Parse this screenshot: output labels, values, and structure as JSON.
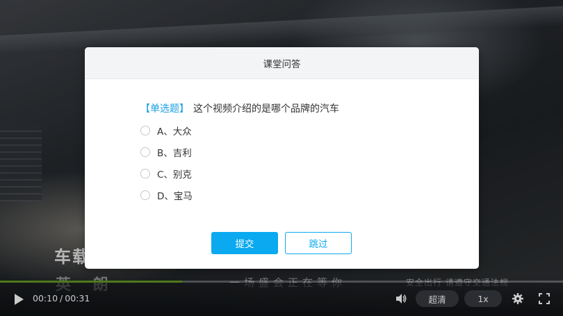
{
  "video": {
    "overlay_title": "车载",
    "overlay_title_2": "英 朗",
    "overlay_subtitle": "一场盛会正在等你",
    "overlay_notice": "安全出行 请遵守交通法规",
    "progress_fraction": 0.323
  },
  "player": {
    "current_time": "00:10",
    "separator": "/",
    "duration": "00:31",
    "quality_label": "超清",
    "speed_label": "1x",
    "icons": {
      "play": "play-icon",
      "volume": "volume-icon",
      "settings": "gear-icon",
      "fullscreen": "fullscreen-icon"
    }
  },
  "quiz": {
    "title": "课堂问答",
    "question_type": "【单选题】",
    "question_text": "这个视频介绍的是哪个品牌的汽车",
    "options": [
      {
        "label": "A、大众"
      },
      {
        "label": "B、吉利"
      },
      {
        "label": "C、别克"
      },
      {
        "label": "D、宝马"
      }
    ],
    "submit_label": "提交",
    "skip_label": "跳过"
  },
  "colors": {
    "accent": "#0aa9f0",
    "question_type": "#1aa0e6",
    "progress": "#5a8a1e"
  }
}
